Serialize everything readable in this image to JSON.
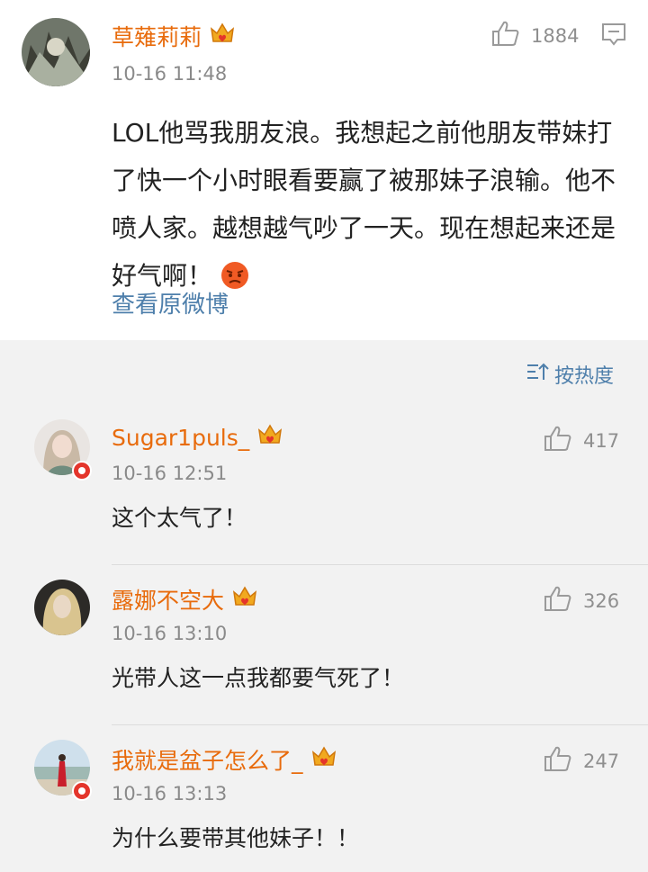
{
  "post": {
    "author": "草薙莉莉",
    "time": "10-16 11:48",
    "likes": "1884",
    "text": "LOL他骂我朋友浪。我想起之前他朋友带妹打了快一个小时眼看要赢了被那妹子浪输。他不喷人家。越想越气吵了一天。现在想起来还是好气啊！",
    "view_original": "查看原微博"
  },
  "sort": {
    "label": "按热度"
  },
  "comments": [
    {
      "user": "Sugar1puls_",
      "time": "10-16 12:51",
      "likes": "417",
      "text": "这个太气了！"
    },
    {
      "user": "露娜不空大",
      "time": "10-16 13:10",
      "likes": "326",
      "text": "光带人这一点我都要气死了！"
    },
    {
      "user": "我就是盆子怎么了_",
      "time": "10-16 13:13",
      "likes": "247",
      "text": "为什么要带其他妹子！！"
    }
  ],
  "colors": {
    "username": "#e86b0c",
    "link": "#4e7fab",
    "secondary": "#8a8a8a"
  },
  "icons": [
    "thumbs-up-icon",
    "comment-icon",
    "crown-badge-icon",
    "angry-emoji-icon",
    "sort-icon",
    "verified-badge-icon"
  ]
}
